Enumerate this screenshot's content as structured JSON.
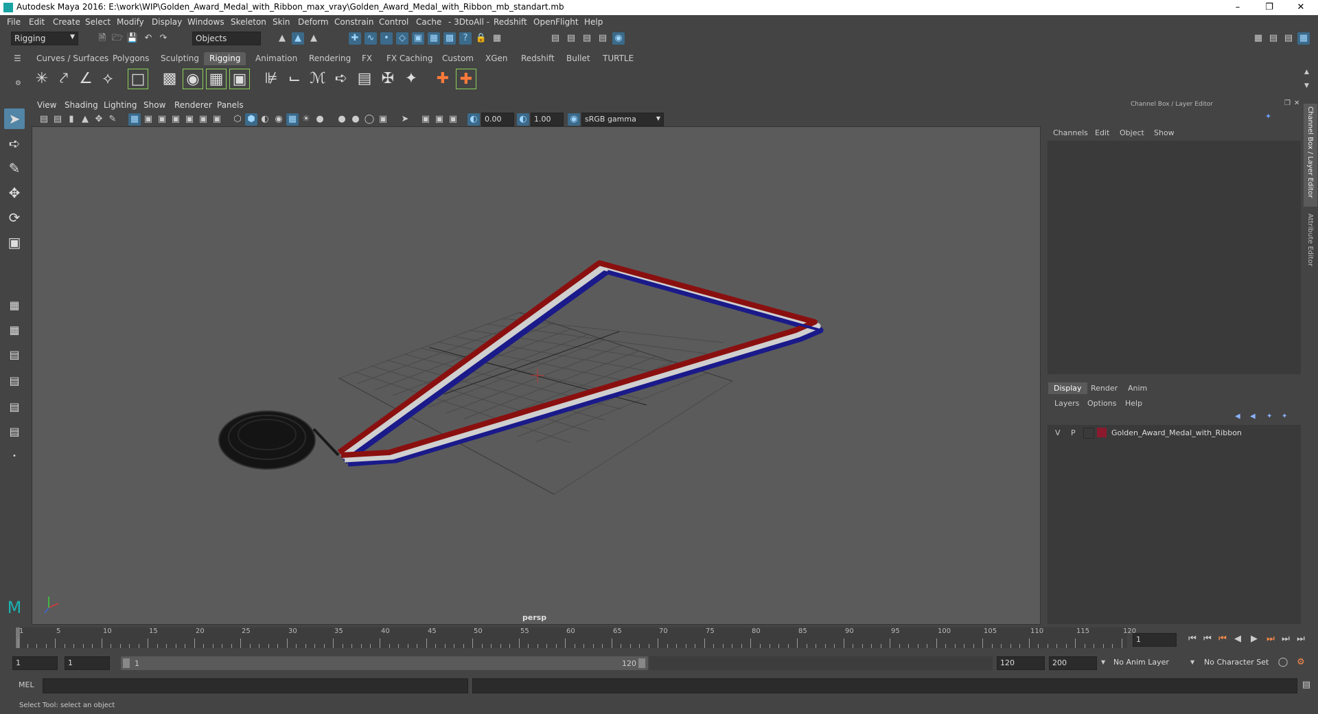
{
  "window": {
    "title": "Autodesk Maya 2016: E:\\work\\WIP\\Golden_Award_Medal_with_Ribbon_max_vray\\Golden_Award_Medal_with_Ribbon_mb_standart.mb"
  },
  "menubar": [
    "File",
    "Edit",
    "Create",
    "Select",
    "Modify",
    "Display",
    "Windows",
    "Skeleton",
    "Skin",
    "Deform",
    "Constrain",
    "Control",
    "Cache",
    "- 3DtoAll -",
    "Redshift",
    "OpenFlight",
    "Help"
  ],
  "statusline": {
    "mode": "Rigging",
    "selection_mask": "Objects"
  },
  "shelf": {
    "tabs": [
      "Curves / Surfaces",
      "Polygons",
      "Sculpting",
      "Rigging",
      "Animation",
      "Rendering",
      "FX",
      "FX Caching",
      "Custom",
      "XGen",
      "Redshift",
      "Bullet",
      "TURTLE"
    ],
    "active_tab": "Rigging"
  },
  "viewport": {
    "menu": [
      "View",
      "Shading",
      "Lighting",
      "Show",
      "Renderer",
      "Panels"
    ],
    "exposure": "0.00",
    "gamma": "1.00",
    "color_space": "sRGB gamma",
    "camera_label": "persp"
  },
  "channel_box": {
    "title": "Channel Box / Layer Editor",
    "menu": [
      "Channels",
      "Edit",
      "Object",
      "Show"
    ]
  },
  "layer_editor": {
    "tabs": [
      "Display",
      "Render",
      "Anim"
    ],
    "active_tab": "Display",
    "menu": [
      "Layers",
      "Options",
      "Help"
    ],
    "layers": [
      {
        "v": "V",
        "p": "P",
        "color": "#8b1a2e",
        "name": "Golden_Award_Medal_with_Ribbon"
      }
    ]
  },
  "side_tabs": {
    "channel_box": "Channel Box / Layer Editor",
    "attribute_editor": "Attribute Editor"
  },
  "timeline": {
    "ticks": [
      "1",
      "5",
      "10",
      "15",
      "20",
      "25",
      "30",
      "35",
      "40",
      "45",
      "50",
      "55",
      "60",
      "65",
      "70",
      "75",
      "80",
      "85",
      "90",
      "95",
      "100",
      "105",
      "110",
      "115",
      "120"
    ],
    "current_frame": "1"
  },
  "range": {
    "start": "1",
    "playback_start": "1",
    "slider_start": "1",
    "slider_end": "120",
    "playback_end": "120",
    "end": "200",
    "anim_layer": "No Anim Layer",
    "character_set": "No Character Set"
  },
  "command_line": {
    "label": "MEL"
  },
  "help_line": {
    "text": "Select Tool: select an object"
  }
}
